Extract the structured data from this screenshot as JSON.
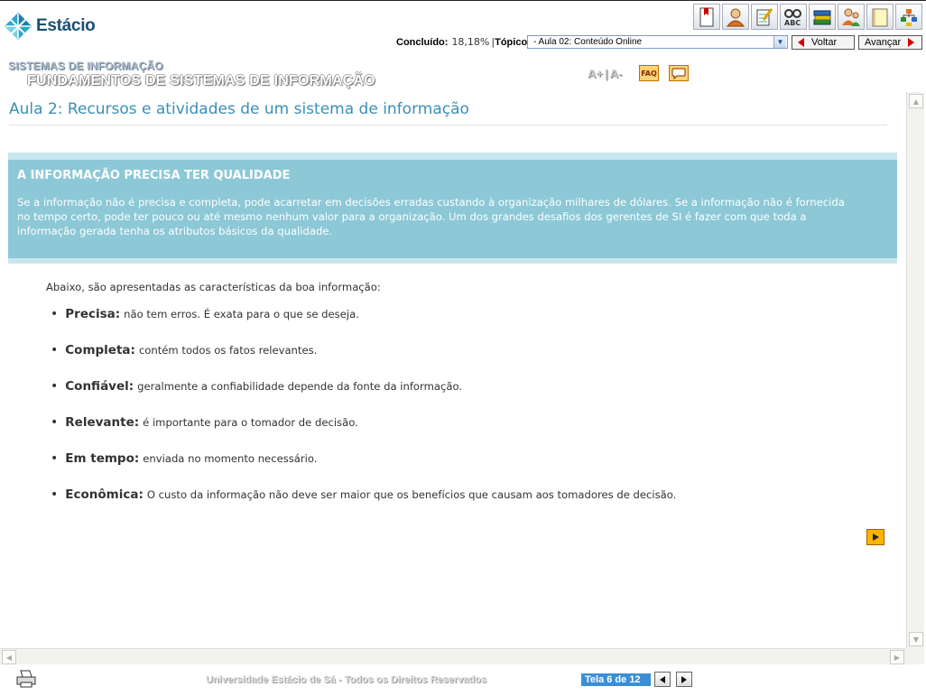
{
  "header": {
    "logo_text": "Estácio",
    "toolbar_icons": [
      "bookmark-icon",
      "user-icon",
      "notepad-icon",
      "dictionary-icon",
      "books-icon",
      "users-icon",
      "notes-icon",
      "map-icon"
    ],
    "progress_label": "Concluído:",
    "progress_value": "18,18%",
    "separator": "|",
    "topic_label": "Tópico",
    "topic_selected": "- Aula 02: Conteúdo Online",
    "back_label": "Voltar",
    "next_label": "Avançar",
    "course_line1": "SISTEMAS DE INFORMAÇÃO",
    "course_line2": "FUNDAMENTOS DE SISTEMAS DE INFORMAÇÃO",
    "font_increase": "A+",
    "font_separator": "|",
    "font_decrease": "A-",
    "faq_label": "FAQ"
  },
  "content": {
    "lesson_title": "Aula 2: Recursos e atividades de um sistema de informação",
    "callout_title": "A INFORMAÇÃO PRECISA TER QUALIDADE",
    "callout_text": "Se a informação não é precisa e completa, pode acarretar em decisões erradas custando à organização milhares de dólares. Se a informação não é fornecida no tempo certo, pode ter pouco ou até mesmo nenhum valor para a organização. Um dos grandes desafios dos gerentes de SI é fazer com que toda a informação gerada tenha os atributos básicos da qualidade.",
    "intro": "Abaixo, são apresentadas as características da boa informação:",
    "bullet": "•",
    "items": [
      {
        "term": "Precisa:",
        "desc": "não tem erros. É exata para o que se deseja."
      },
      {
        "term": "Completa:",
        "desc": "contém todos os fatos relevantes."
      },
      {
        "term": "Confiável:",
        "desc": "geralmente a confiabilidade depende da fonte da informação."
      },
      {
        "term": "Relevante:",
        "desc": "é importante para o tomador de decisão."
      },
      {
        "term": "Em tempo:",
        "desc": "enviada no momento necessário."
      },
      {
        "term": "Econômica:",
        "desc": "O custo da informação não deve ser maior que os benefícios que causam aos tomadores de decisão."
      }
    ]
  },
  "footer": {
    "copyright": "Universidade Estácio de Sá - Todos os Direitos Reservados",
    "page_indicator": "Tela 6 de 12"
  },
  "colors": {
    "accent_title": "#3a8fb6",
    "callout_bg": "#8cc8d6",
    "callout_border": "#c8e6ee",
    "pager_bg": "#3a8fd6",
    "arrow_red": "#d10000"
  }
}
